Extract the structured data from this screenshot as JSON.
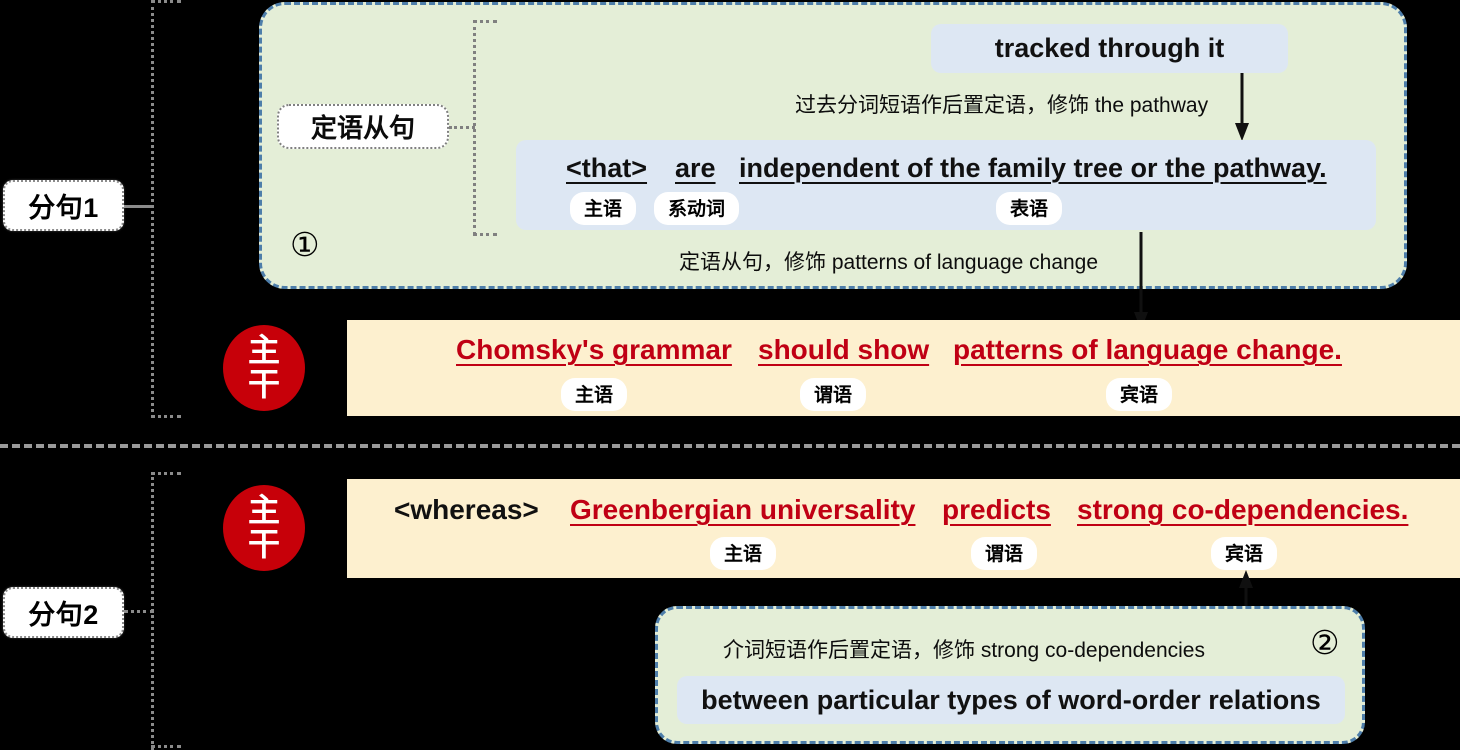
{
  "clause1": {
    "side_label": "分句1",
    "marker": "①",
    "tag": "定语从句",
    "top_phrase": "tracked through it",
    "note_top": "过去分词短语作后置定语，修饰 the pathway",
    "note_bottom": "定语从句，修饰 patterns of language change",
    "sub_clause": {
      "connector": "<that>",
      "linking_verb": "are",
      "predicative": "independent of the family tree or the pathway.",
      "roles": {
        "subject": "主语",
        "linking": "系动词",
        "predicative": "表语"
      }
    },
    "main_clause": {
      "badge_line1": "主",
      "badge_line2": "干",
      "subject": "Chomsky's grammar",
      "predicate": "should show",
      "object": "patterns of language change.",
      "roles": {
        "subject": "主语",
        "predicate": "谓语",
        "object": "宾语"
      }
    }
  },
  "clause2": {
    "side_label": "分句2",
    "marker": "②",
    "note": "介词短语作后置定语，修饰 strong co-dependencies",
    "phrase": "between particular types of word-order relations",
    "main_clause": {
      "badge_line1": "主",
      "badge_line2": "干",
      "connector": "<whereas>",
      "subject": "Greenbergian universality",
      "predicate": "predicts",
      "object": "strong co-dependencies.",
      "roles": {
        "subject": "主语",
        "predicate": "谓语",
        "object": "宾语"
      }
    }
  },
  "colors": {
    "background": "#000000",
    "green_panel": "#e4eed7",
    "green_border": "#4e7eaa",
    "blue_chip": "#dde7f3",
    "yellow_band": "#fdf0cf",
    "red_accent": "#c00014",
    "badge_red": "#c70009",
    "dotted_gray": "#8b8b8b"
  }
}
